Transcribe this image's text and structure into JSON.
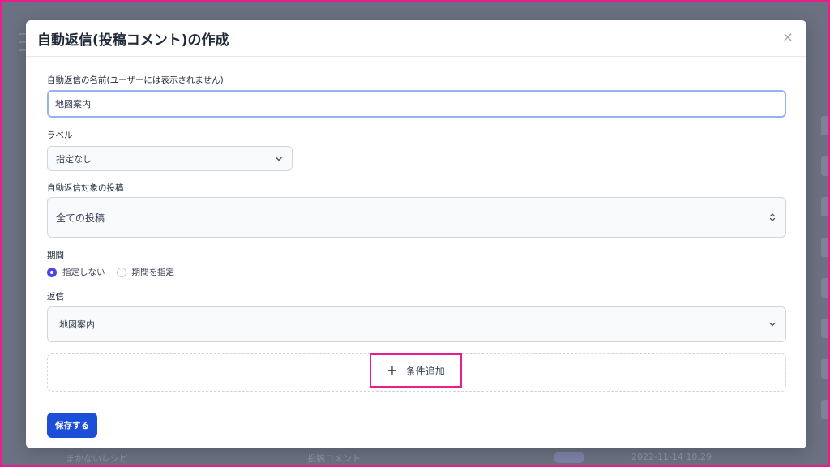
{
  "modal": {
    "title": "自動返信(投稿コメント)の作成",
    "close_glyph": "×"
  },
  "fields": {
    "name": {
      "label": "自動返信の名前(ユーザーには表示されません)",
      "value": "地図案内"
    },
    "label": {
      "label": "ラベル",
      "selected": "指定なし"
    },
    "target_post": {
      "label": "自動返信対象の投稿",
      "selected": "全ての投稿"
    },
    "period": {
      "label": "期間",
      "options": [
        {
          "label": "指定しない",
          "checked": true
        },
        {
          "label": "期間を指定",
          "checked": false
        }
      ]
    },
    "reply": {
      "label": "返信",
      "selected": "地図案内"
    }
  },
  "actions": {
    "add_condition_label": "条件追加",
    "save_label": "保存する"
  },
  "background": {
    "row_col1": "まかないレシピ",
    "row_col2": "投稿コメント",
    "row_col3": "2022-11-14 10:29"
  },
  "colors": {
    "accent": "#1d4ed8",
    "radio": "#4f46e5",
    "highlight": "#e91e8c",
    "overlay": "#6b7180"
  },
  "icons": {
    "close": "close-icon",
    "chevron": "chevron-down-icon",
    "updown": "chevron-up-down-icon",
    "plus": "plus-icon"
  }
}
